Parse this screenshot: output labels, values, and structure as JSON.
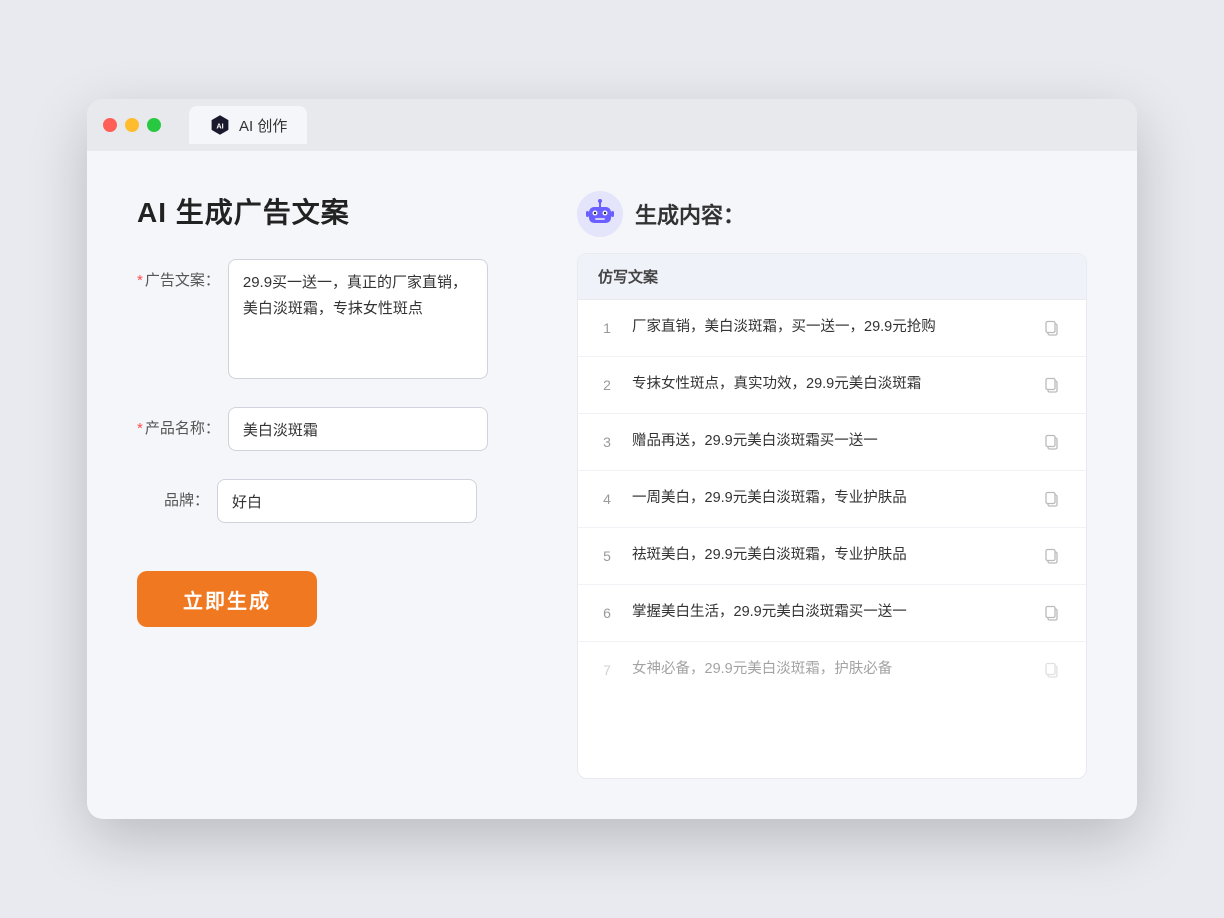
{
  "browser": {
    "tab_label": "AI 创作"
  },
  "page": {
    "title": "AI 生成广告文案"
  },
  "form": {
    "ad_copy_label": "广告文案：",
    "ad_copy_required": "*",
    "ad_copy_value": "29.9买一送一，真正的厂家直销，美白淡斑霜，专抹女性斑点",
    "product_name_label": "产品名称：",
    "product_name_required": "*",
    "product_name_value": "美白淡斑霜",
    "brand_label": "品牌：",
    "brand_value": "好白",
    "generate_button": "立即生成"
  },
  "result": {
    "header": "生成内容：",
    "column_label": "仿写文案",
    "items": [
      {
        "num": "1",
        "text": "厂家直销，美白淡斑霜，买一送一，29.9元抢购",
        "dim": false
      },
      {
        "num": "2",
        "text": "专抹女性斑点，真实功效，29.9元美白淡斑霜",
        "dim": false
      },
      {
        "num": "3",
        "text": "赠品再送，29.9元美白淡斑霜买一送一",
        "dim": false
      },
      {
        "num": "4",
        "text": "一周美白，29.9元美白淡斑霜，专业护肤品",
        "dim": false
      },
      {
        "num": "5",
        "text": "祛斑美白，29.9元美白淡斑霜，专业护肤品",
        "dim": false
      },
      {
        "num": "6",
        "text": "掌握美白生活，29.9元美白淡斑霜买一送一",
        "dim": false
      },
      {
        "num": "7",
        "text": "女神必备，29.9元美白淡斑霜，护肤必备",
        "dim": true
      }
    ]
  }
}
